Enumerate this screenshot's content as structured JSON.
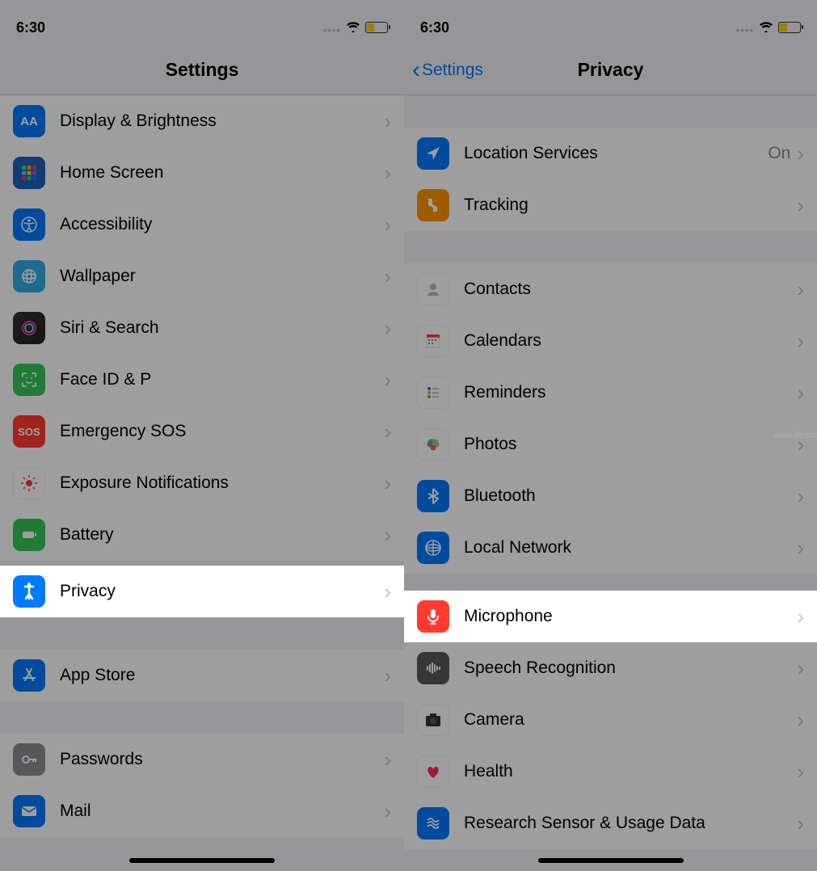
{
  "watermark": "www.deuaq.com",
  "left": {
    "status": {
      "time": "6:30"
    },
    "nav": {
      "title": "Settings"
    },
    "rows": [
      {
        "label": "Display & Brightness"
      },
      {
        "label": "Home Screen"
      },
      {
        "label": "Accessibility"
      },
      {
        "label": "Wallpaper"
      },
      {
        "label": "Siri & Search"
      },
      {
        "label": "Face ID & P"
      },
      {
        "label": "Emergency SOS"
      },
      {
        "label": "Exposure Notifications"
      },
      {
        "label": "Battery"
      },
      {
        "label": "Privacy"
      },
      {
        "label": "App Store"
      },
      {
        "label": "Passwords"
      },
      {
        "label": "Mail"
      }
    ]
  },
  "right": {
    "status": {
      "time": "6:30"
    },
    "nav": {
      "back": "Settings",
      "title": "Privacy"
    },
    "rows": [
      {
        "label": "Location Services",
        "detail": "On"
      },
      {
        "label": "Tracking"
      },
      {
        "label": "Contacts"
      },
      {
        "label": "Calendars"
      },
      {
        "label": "Reminders"
      },
      {
        "label": "Photos"
      },
      {
        "label": "Bluetooth"
      },
      {
        "label": "Local Network"
      },
      {
        "label": "Microphone"
      },
      {
        "label": "Speech Recognition"
      },
      {
        "label": "Camera"
      },
      {
        "label": "Health"
      },
      {
        "label": "Research Sensor & Usage Data"
      }
    ]
  }
}
